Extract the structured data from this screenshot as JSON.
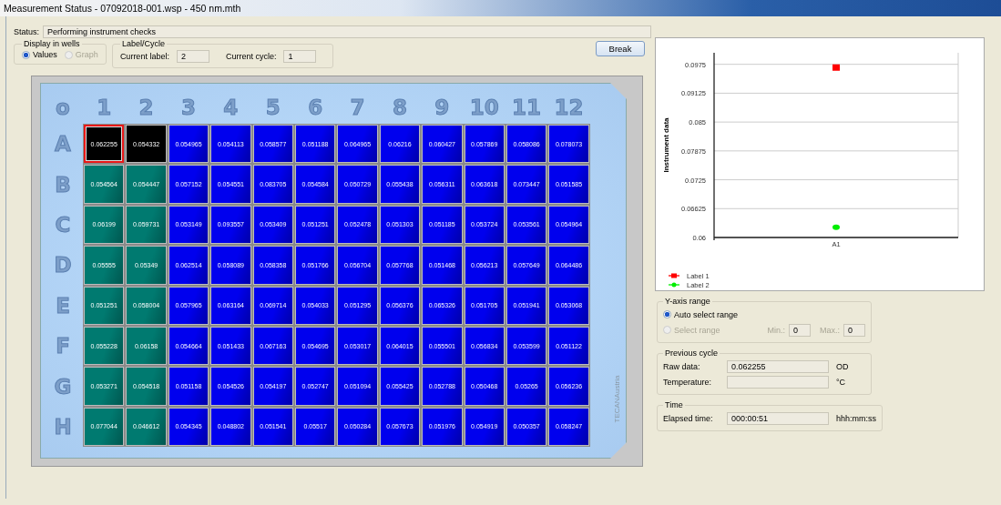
{
  "window": {
    "title": "Measurement Status - 07092018-001.wsp - 450 nm.mth"
  },
  "status": {
    "label": "Status:",
    "value": "Performing instrument checks"
  },
  "display_in_wells": {
    "title": "Display in wells",
    "options": [
      {
        "label": "Values",
        "selected": true,
        "disabled": false
      },
      {
        "label": "Graph",
        "selected": false,
        "disabled": true
      }
    ]
  },
  "label_cycle": {
    "title": "Label/Cycle",
    "fields": [
      {
        "label": "Current label:",
        "value": "2"
      },
      {
        "label": "Current cycle:",
        "value": "1"
      }
    ]
  },
  "break_button": "Break",
  "plate": {
    "corner": "o",
    "columns": [
      "1",
      "2",
      "3",
      "4",
      "5",
      "6",
      "7",
      "8",
      "9",
      "10",
      "11",
      "12"
    ],
    "brand_text": "TECANAustria",
    "rows": [
      {
        "label": "A",
        "wells": [
          {
            "value": "0.062255",
            "color": "#000000",
            "selected": true
          },
          {
            "value": "0.054332",
            "color": "#000000",
            "selected": false
          },
          {
            "value": "0.054965",
            "color": "#0000ee",
            "selected": false
          },
          {
            "value": "0.054113",
            "color": "#0000ee",
            "selected": false
          },
          {
            "value": "0.058577",
            "color": "#0000ee",
            "selected": false
          },
          {
            "value": "0.051188",
            "color": "#0000ee",
            "selected": false
          },
          {
            "value": "0.064965",
            "color": "#0000ee",
            "selected": false
          },
          {
            "value": "0.06216",
            "color": "#0000ee",
            "selected": false
          },
          {
            "value": "0.060427",
            "color": "#0000ee",
            "selected": false
          },
          {
            "value": "0.057869",
            "color": "#0000ee",
            "selected": false
          },
          {
            "value": "0.058086",
            "color": "#0000ee",
            "selected": false
          },
          {
            "value": "0.078073",
            "color": "#0000ee",
            "selected": false
          }
        ]
      },
      {
        "label": "B",
        "wells": [
          {
            "value": "0.054564",
            "color": "#007a70",
            "selected": false
          },
          {
            "value": "0.054447",
            "color": "#007a70",
            "selected": false
          },
          {
            "value": "0.057152",
            "color": "#0000ee",
            "selected": false
          },
          {
            "value": "0.054551",
            "color": "#0000ee",
            "selected": false
          },
          {
            "value": "0.083705",
            "color": "#0000ee",
            "selected": false
          },
          {
            "value": "0.054584",
            "color": "#0000ee",
            "selected": false
          },
          {
            "value": "0.050729",
            "color": "#0000ee",
            "selected": false
          },
          {
            "value": "0.055438",
            "color": "#0000ee",
            "selected": false
          },
          {
            "value": "0.056311",
            "color": "#0000ee",
            "selected": false
          },
          {
            "value": "0.063618",
            "color": "#0000ee",
            "selected": false
          },
          {
            "value": "0.073447",
            "color": "#0000ee",
            "selected": false
          },
          {
            "value": "0.051585",
            "color": "#0000ee",
            "selected": false
          }
        ]
      },
      {
        "label": "C",
        "wells": [
          {
            "value": "0.06199",
            "color": "#007a70",
            "selected": false
          },
          {
            "value": "0.059731",
            "color": "#007a70",
            "selected": false
          },
          {
            "value": "0.053149",
            "color": "#0000ee",
            "selected": false
          },
          {
            "value": "0.093557",
            "color": "#0000ee",
            "selected": false
          },
          {
            "value": "0.053409",
            "color": "#0000ee",
            "selected": false
          },
          {
            "value": "0.051251",
            "color": "#0000ee",
            "selected": false
          },
          {
            "value": "0.052478",
            "color": "#0000ee",
            "selected": false
          },
          {
            "value": "0.051303",
            "color": "#0000ee",
            "selected": false
          },
          {
            "value": "0.051185",
            "color": "#0000ee",
            "selected": false
          },
          {
            "value": "0.053724",
            "color": "#0000ee",
            "selected": false
          },
          {
            "value": "0.053561",
            "color": "#0000ee",
            "selected": false
          },
          {
            "value": "0.054964",
            "color": "#0000ee",
            "selected": false
          }
        ]
      },
      {
        "label": "D",
        "wells": [
          {
            "value": "0.05555",
            "color": "#007a70",
            "selected": false
          },
          {
            "value": "0.05349",
            "color": "#007a70",
            "selected": false
          },
          {
            "value": "0.062514",
            "color": "#0000ee",
            "selected": false
          },
          {
            "value": "0.058089",
            "color": "#0000ee",
            "selected": false
          },
          {
            "value": "0.058358",
            "color": "#0000ee",
            "selected": false
          },
          {
            "value": "0.051766",
            "color": "#0000ee",
            "selected": false
          },
          {
            "value": "0.056704",
            "color": "#0000ee",
            "selected": false
          },
          {
            "value": "0.057768",
            "color": "#0000ee",
            "selected": false
          },
          {
            "value": "0.051468",
            "color": "#0000ee",
            "selected": false
          },
          {
            "value": "0.056213",
            "color": "#0000ee",
            "selected": false
          },
          {
            "value": "0.057649",
            "color": "#0000ee",
            "selected": false
          },
          {
            "value": "0.064486",
            "color": "#0000ee",
            "selected": false
          }
        ]
      },
      {
        "label": "E",
        "wells": [
          {
            "value": "0.051251",
            "color": "#007a70",
            "selected": false
          },
          {
            "value": "0.058004",
            "color": "#007a70",
            "selected": false
          },
          {
            "value": "0.057965",
            "color": "#0000ee",
            "selected": false
          },
          {
            "value": "0.063164",
            "color": "#0000ee",
            "selected": false
          },
          {
            "value": "0.069714",
            "color": "#0000ee",
            "selected": false
          },
          {
            "value": "0.054033",
            "color": "#0000ee",
            "selected": false
          },
          {
            "value": "0.051295",
            "color": "#0000ee",
            "selected": false
          },
          {
            "value": "0.056376",
            "color": "#0000ee",
            "selected": false
          },
          {
            "value": "0.065326",
            "color": "#0000ee",
            "selected": false
          },
          {
            "value": "0.051705",
            "color": "#0000ee",
            "selected": false
          },
          {
            "value": "0.051941",
            "color": "#0000ee",
            "selected": false
          },
          {
            "value": "0.053068",
            "color": "#0000ee",
            "selected": false
          }
        ]
      },
      {
        "label": "F",
        "wells": [
          {
            "value": "0.055228",
            "color": "#007a70",
            "selected": false
          },
          {
            "value": "0.06158",
            "color": "#007a70",
            "selected": false
          },
          {
            "value": "0.054664",
            "color": "#0000ee",
            "selected": false
          },
          {
            "value": "0.051433",
            "color": "#0000ee",
            "selected": false
          },
          {
            "value": "0.067163",
            "color": "#0000ee",
            "selected": false
          },
          {
            "value": "0.054695",
            "color": "#0000ee",
            "selected": false
          },
          {
            "value": "0.053017",
            "color": "#0000ee",
            "selected": false
          },
          {
            "value": "0.064015",
            "color": "#0000ee",
            "selected": false
          },
          {
            "value": "0.055501",
            "color": "#0000ee",
            "selected": false
          },
          {
            "value": "0.056834",
            "color": "#0000ee",
            "selected": false
          },
          {
            "value": "0.053599",
            "color": "#0000ee",
            "selected": false
          },
          {
            "value": "0.051122",
            "color": "#0000ee",
            "selected": false
          }
        ]
      },
      {
        "label": "G",
        "wells": [
          {
            "value": "0.053271",
            "color": "#007a70",
            "selected": false
          },
          {
            "value": "0.054518",
            "color": "#007a70",
            "selected": false
          },
          {
            "value": "0.051158",
            "color": "#0000ee",
            "selected": false
          },
          {
            "value": "0.054526",
            "color": "#0000ee",
            "selected": false
          },
          {
            "value": "0.054197",
            "color": "#0000ee",
            "selected": false
          },
          {
            "value": "0.052747",
            "color": "#0000ee",
            "selected": false
          },
          {
            "value": "0.051094",
            "color": "#0000ee",
            "selected": false
          },
          {
            "value": "0.055425",
            "color": "#0000ee",
            "selected": false
          },
          {
            "value": "0.052788",
            "color": "#0000ee",
            "selected": false
          },
          {
            "value": "0.050468",
            "color": "#0000ee",
            "selected": false
          },
          {
            "value": "0.05265",
            "color": "#0000ee",
            "selected": false
          },
          {
            "value": "0.056236",
            "color": "#0000ee",
            "selected": false
          }
        ]
      },
      {
        "label": "H",
        "wells": [
          {
            "value": "0.077044",
            "color": "#007a70",
            "selected": false
          },
          {
            "value": "0.046612",
            "color": "#007a70",
            "selected": false
          },
          {
            "value": "0.054345",
            "color": "#0000ee",
            "selected": false
          },
          {
            "value": "0.048802",
            "color": "#0000ee",
            "selected": false
          },
          {
            "value": "0.051541",
            "color": "#0000ee",
            "selected": false
          },
          {
            "value": "0.05517",
            "color": "#0000ee",
            "selected": false
          },
          {
            "value": "0.050284",
            "color": "#0000ee",
            "selected": false
          },
          {
            "value": "0.057673",
            "color": "#0000ee",
            "selected": false
          },
          {
            "value": "0.051976",
            "color": "#0000ee",
            "selected": false
          },
          {
            "value": "0.054919",
            "color": "#0000ee",
            "selected": false
          },
          {
            "value": "0.050357",
            "color": "#0000ee",
            "selected": false
          },
          {
            "value": "0.058247",
            "color": "#0000ee",
            "selected": false
          }
        ]
      }
    ]
  },
  "chart": {
    "chart_data": {
      "type": "scatter",
      "grid": true,
      "legend": true,
      "ylabel": "Instrument data",
      "categories": [
        "A1"
      ],
      "ylim": [
        0.06,
        0.1
      ],
      "yticks": [
        0.06,
        {
          "value": 0.06625,
          "label": "0.06625"
        },
        {
          "value": 0.0725,
          "label": "0.0725"
        },
        {
          "value": 0.07875,
          "label": "0.07875"
        },
        {
          "value": 0.085,
          "label": "0.085"
        },
        {
          "value": 0.09125,
          "label": "0.09125"
        },
        {
          "value": 0.0975,
          "label": "0.0975"
        }
      ],
      "series": [
        {
          "name": "Label 1",
          "color": "#ff0000",
          "values": [
            0.0968
          ]
        },
        {
          "name": "Label 2",
          "color": "#00ee00",
          "values": [
            0.0622
          ]
        }
      ]
    }
  },
  "y_axis_range": {
    "title": "Y-axis range",
    "options": [
      {
        "label": "Auto select range",
        "selected": true,
        "disabled": false
      },
      {
        "label": "Select range",
        "selected": false,
        "disabled": true
      }
    ],
    "min": {
      "label": "Min.:",
      "value": "0"
    },
    "max": {
      "label": "Max.:",
      "value": "0"
    }
  },
  "previous_cycle": {
    "title": "Previous cycle",
    "rows": [
      {
        "label": "Raw data:",
        "value": "0.062255",
        "unit": "OD"
      },
      {
        "label": "Temperature:",
        "unit": "°C"
      }
    ]
  },
  "time": {
    "title": "Time",
    "label": "Elapsed time:",
    "value": "000:00:51",
    "unit": "hhh:mm:ss"
  }
}
